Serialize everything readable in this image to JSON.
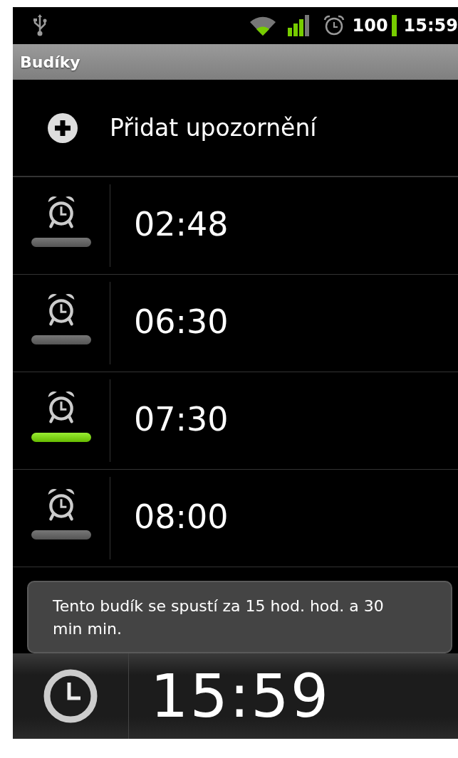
{
  "status_bar": {
    "battery": "100",
    "time": "15:59"
  },
  "title": "Budíky",
  "add_alarm": {
    "label": "Přidat upozornění"
  },
  "alarms": [
    {
      "time": "02:48",
      "enabled": false
    },
    {
      "time": "06:30",
      "enabled": false
    },
    {
      "time": "07:30",
      "enabled": true
    },
    {
      "time": "08:00",
      "enabled": false
    }
  ],
  "toast": {
    "text": "Tento budík se spustí za 15 hod. hod. a 30 min min."
  },
  "clock": {
    "time": "15:59"
  }
}
